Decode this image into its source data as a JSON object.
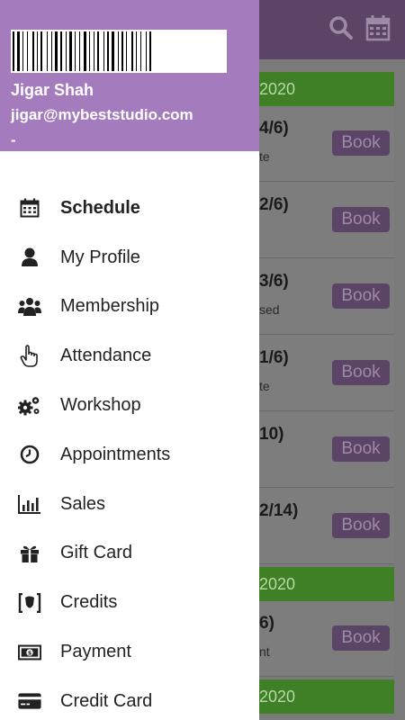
{
  "app": {
    "bg_headers": [
      "2020",
      "2020",
      "2020"
    ],
    "bg_cards": [
      {
        "ratio": "4/6)",
        "sub": "te",
        "book": "Book"
      },
      {
        "ratio": "2/6)",
        "sub": "",
        "book": "Book"
      },
      {
        "ratio": "3/6)",
        "sub": "sed",
        "book": "Book"
      },
      {
        "ratio": "1/6)",
        "sub": "te",
        "book": "Book"
      },
      {
        "ratio": "10)",
        "sub": "",
        "book": "Book"
      },
      {
        "ratio": "2/14)",
        "sub": "",
        "book": "Book"
      },
      {
        "ratio": "6)",
        "sub": "nt",
        "book": "Book"
      }
    ]
  },
  "drawer": {
    "user": {
      "name": "Jigar Shah",
      "email": "jigar@mybeststudio.com",
      "extra": "-"
    },
    "menu": [
      {
        "label": "Schedule",
        "icon": "calendar-icon",
        "active": true
      },
      {
        "label": "My Profile",
        "icon": "user-icon"
      },
      {
        "label": "Membership",
        "icon": "group-icon"
      },
      {
        "label": "Attendance",
        "icon": "hand-pointer-icon"
      },
      {
        "label": "Workshop",
        "icon": "gears-icon"
      },
      {
        "label": "Appointments",
        "icon": "clock-icon"
      },
      {
        "label": "Sales",
        "icon": "bar-chart-icon"
      },
      {
        "label": "Gift Card",
        "icon": "gift-icon"
      },
      {
        "label": "Credits",
        "icon": "credits-icon"
      },
      {
        "label": "Payment",
        "icon": "money-icon"
      },
      {
        "label": "Credit Card",
        "icon": "credit-card-icon"
      }
    ]
  },
  "colors": {
    "drawer_header": "#a47bbd",
    "topbar": "#5b4466",
    "section_header": "#3f7f26"
  }
}
